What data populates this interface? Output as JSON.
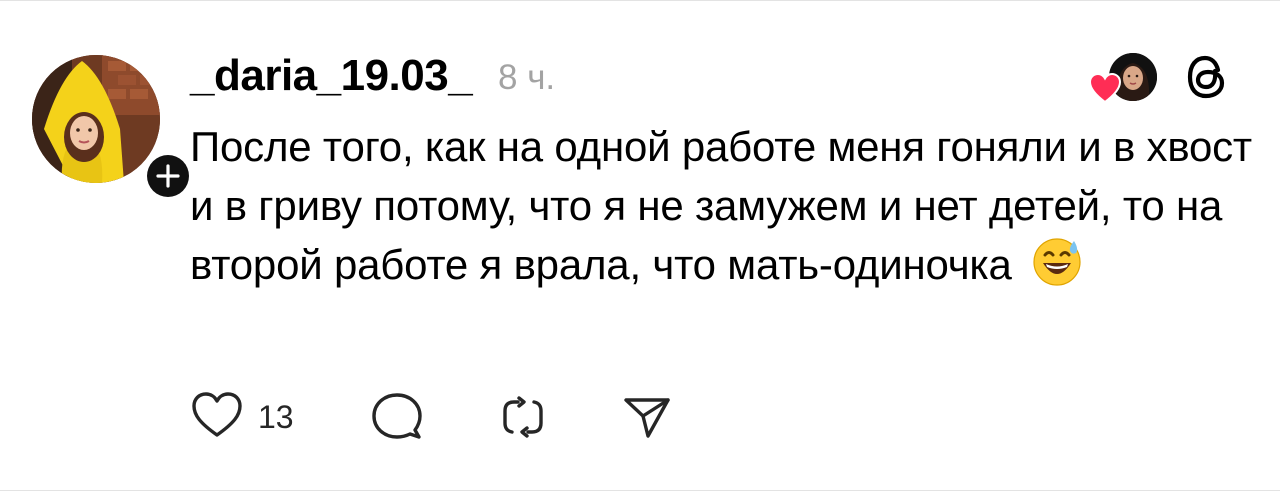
{
  "post": {
    "username": "_daria_19.03_",
    "timestamp": "8 ч.",
    "text": "После того, как на одной работе меня гоняли и в хвост и в гриву потому, что я не замужем и нет детей, то на второй работе я врала, что мать-одиночка",
    "emoji": "😅"
  },
  "actions": {
    "like_count": "13"
  },
  "icons": {
    "like": "heart-outline-icon",
    "comment": "speech-bubble-icon",
    "repost": "repost-arrows-icon",
    "share": "paper-plane-icon",
    "app": "threads-logo-icon",
    "follow": "plus-icon",
    "liked_by": "red-heart-icon"
  },
  "colors": {
    "text": "#000000",
    "muted": "#a3a3a3",
    "heart": "#ff2d55",
    "avatar_coat": "#f4d21a"
  }
}
